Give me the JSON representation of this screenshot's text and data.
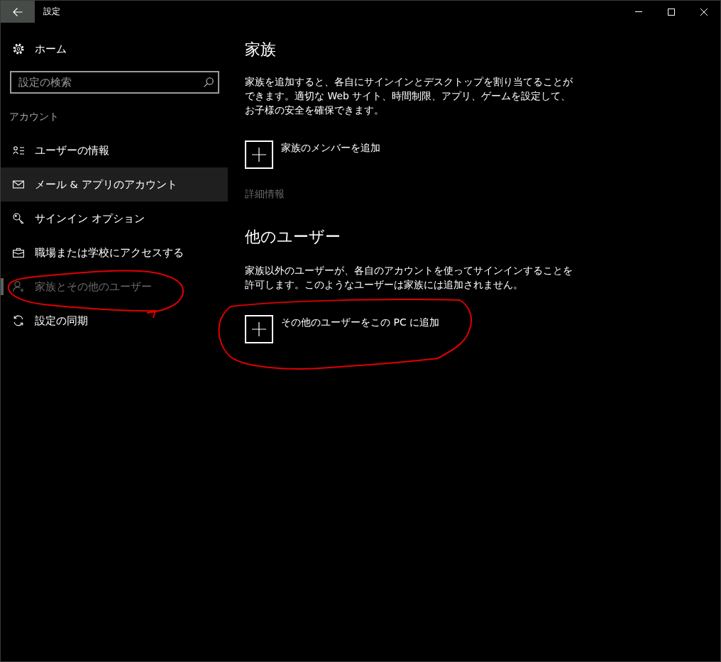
{
  "window": {
    "title": "設定"
  },
  "sidebar": {
    "home": "ホーム",
    "search": {
      "placeholder": "設定の検索"
    },
    "section": "アカウント",
    "items": [
      {
        "label": "ユーザーの情報",
        "selected": false,
        "highlighted": false,
        "disabled": false,
        "circled": false
      },
      {
        "label": "メール & アプリのアカウント",
        "selected": false,
        "highlighted": true,
        "disabled": false,
        "circled": false
      },
      {
        "label": "サインイン オプション",
        "selected": false,
        "highlighted": false,
        "disabled": false,
        "circled": false
      },
      {
        "label": "職場または学校にアクセスする",
        "selected": false,
        "highlighted": false,
        "disabled": false,
        "circled": false
      },
      {
        "label": "家族とその他のユーザー",
        "selected": true,
        "highlighted": false,
        "disabled": true,
        "circled": true
      },
      {
        "label": "設定の同期",
        "selected": false,
        "highlighted": false,
        "disabled": false,
        "circled": false
      }
    ]
  },
  "main": {
    "family": {
      "heading": "家族",
      "description": "家族を追加すると、各自にサインインとデスクトップを割り当てることができます。適切な Web サイト、時間制限、アプリ、ゲームを設定して、お子様の安全を確保できます。",
      "add_button": {
        "label": "家族のメンバーを追加"
      },
      "link": {
        "label": "詳細情報",
        "disabled": true
      }
    },
    "other_users": {
      "heading": "他のユーザー",
      "description": "家族以外のユーザーが、各自のアカウントを使ってサインインすることを許可します。このようなユーザーは家族には追加されません。",
      "add_button": {
        "label": "その他のユーザーをこの PC に追加",
        "circled": true
      }
    }
  }
}
